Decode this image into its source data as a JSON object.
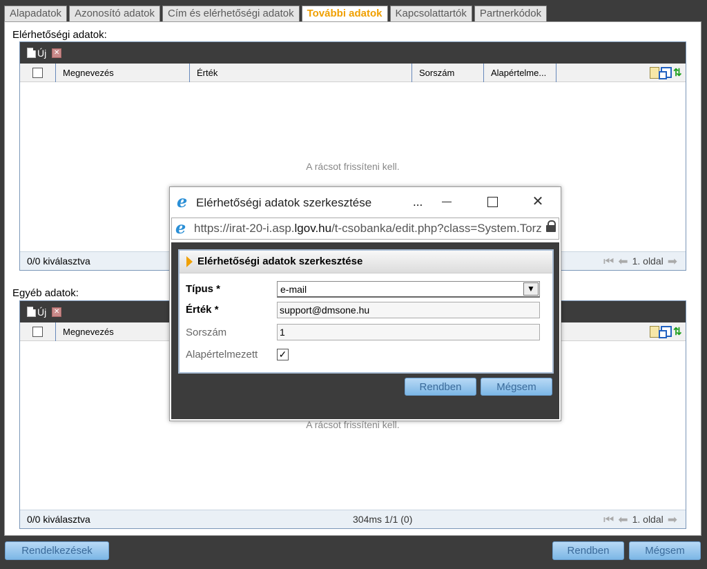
{
  "tabs": [
    {
      "label": "Alapadatok",
      "active": false
    },
    {
      "label": "Azonosító adatok",
      "active": false
    },
    {
      "label": "Cím és elérhetőségi adatok",
      "active": false
    },
    {
      "label": "További adatok",
      "active": true
    },
    {
      "label": "Kapcsolattartók",
      "active": false
    },
    {
      "label": "Partnerkódok",
      "active": false
    }
  ],
  "contact_section": {
    "label": "Elérhetőségi adatok:",
    "new_label": "Új",
    "columns": [
      "Megnevezés",
      "Érték",
      "Sorszám",
      "Alapértelme..."
    ],
    "empty_message": "A rácsot frissíteni kell.",
    "footer_selected": "0/0 kiválasztva",
    "footer_page": "1. oldal"
  },
  "other_section": {
    "label": "Egyéb adatok:",
    "new_label": "Új",
    "columns": [
      "Megnevezés"
    ],
    "empty_message": "A rácsot frissíteni kell.",
    "footer_selected": "0/0 kiválasztva",
    "footer_timing": "304ms 1/1 (0)",
    "footer_page": "1. oldal"
  },
  "popup": {
    "window_title": "Elérhetőségi adatok szerkesztése",
    "dots": "...",
    "address_prefix": "https://irat-20-i.asp.",
    "address_domain": "lgov.hu",
    "address_suffix": "/t-csobanka/edit.php?class=System.Torz",
    "panel_title": "Elérhetőségi adatok szerkesztése",
    "fields": {
      "type_label": "Típus *",
      "type_value": "e-mail",
      "value_label": "Érték *",
      "value_value": "support@dmsone.hu",
      "order_label": "Sorszám",
      "order_value": "1",
      "default_label": "Alapértelmezett",
      "default_checked": true,
      "check_mark": "✓"
    },
    "ok_label": "Rendben",
    "cancel_label": "Mégsem"
  },
  "bottom_bar": {
    "actions_label": "Rendelkezések",
    "ok_label": "Rendben",
    "cancel_label": "Mégsem"
  },
  "icons": {
    "new": "new-document-icon",
    "delete": "delete-icon",
    "export": "export-sheet-icon",
    "window": "window-icon",
    "refresh": "refresh-icon",
    "browser": "internet-explorer-icon",
    "lock": "lock-icon"
  },
  "colors": {
    "active_tab": "#f0a000",
    "toolbar_bg": "#3c3c3c",
    "button_gradient_top": "#b8d9f5",
    "button_gradient_bottom": "#7cb7e6"
  }
}
